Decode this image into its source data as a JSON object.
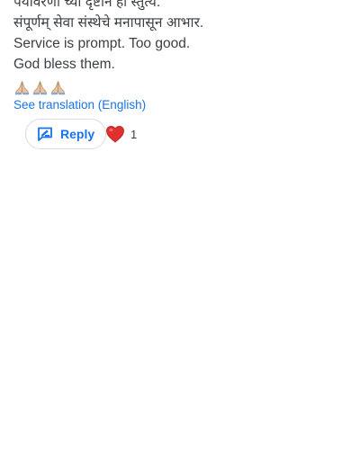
{
  "review": {
    "lines": [
      "पर्यावरणी च्या दृष्टीने ही स्तुत्य.",
      "संपूर्णम् सेवा संस्थेचे मनापासून आभार.",
      "Service is prompt. Too good.",
      "God bless them."
    ],
    "emoji": [
      "folded-hands-icon",
      "folded-hands-icon",
      "folded-hands-icon"
    ]
  },
  "translation_link": "See translation (English)",
  "actions": {
    "reply_label": "Reply",
    "reaction_icon": "red-heart-icon",
    "reaction_count": "1"
  },
  "colors": {
    "link": "#1a73e8",
    "text": "#3c4043",
    "heart": "#e0312f",
    "emoji_skin": "#e8c4a4"
  }
}
